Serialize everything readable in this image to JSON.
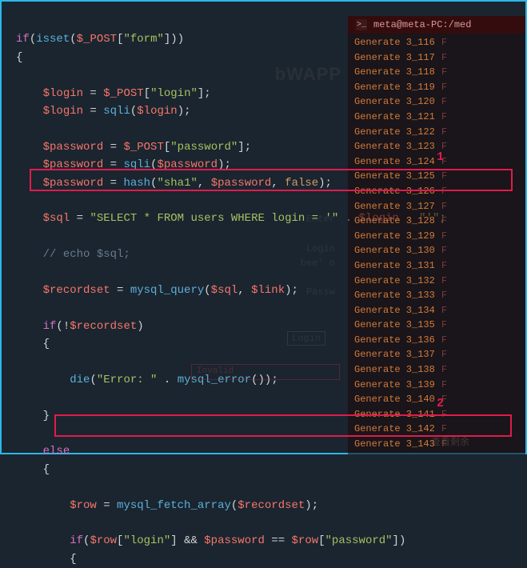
{
  "code": {
    "l1a": "if",
    "l1b": "(",
    "l1c": "isset",
    "l1d": "(",
    "l1e": "$_POST",
    "l1f": "[",
    "l1g": "\"form\"",
    "l1h": "]))",
    "l2": "{",
    "l3a": "$login",
    "l3b": " = ",
    "l3c": "$_POST",
    "l3d": "[",
    "l3e": "\"login\"",
    "l3f": "];",
    "l4a": "$login",
    "l4b": " = ",
    "l4c": "sqli",
    "l4d": "(",
    "l4e": "$login",
    "l4f": ");",
    "l5a": "$password",
    "l5b": " = ",
    "l5c": "$_POST",
    "l5d": "[",
    "l5e": "\"password\"",
    "l5f": "];",
    "l6a": "$password",
    "l6b": " = ",
    "l6c": "sqli",
    "l6d": "(",
    "l6e": "$password",
    "l6f": ");",
    "l7a": "$password",
    "l7b": " = ",
    "l7c": "hash",
    "l7d": "(",
    "l7e": "\"sha1\"",
    "l7f": ", ",
    "l7g": "$password",
    "l7h": ", ",
    "l7i": "false",
    "l7j": ");",
    "l8a": "$sql",
    "l8b": " = ",
    "l8c": "\"SELECT * FROM users WHERE login = '\"",
    "l8d": " . ",
    "l8e": "$login",
    "l8f": " . ",
    "l8g": "\"'\"",
    "l8h": ";",
    "l9": "// echo $sql;",
    "l10a": "$recordset",
    "l10b": " = ",
    "l10c": "mysql_query",
    "l10d": "(",
    "l10e": "$sql",
    "l10f": ", ",
    "l10g": "$link",
    "l10h": ");",
    "l11a": "if",
    "l11b": "(!",
    "l11c": "$recordset",
    "l11d": ")",
    "l12": "{",
    "l13a": "die",
    "l13b": "(",
    "l13c": "\"Error: \"",
    "l13d": " . ",
    "l13e": "mysql_error",
    "l13f": "());",
    "l14": "}",
    "l15": "else",
    "l16": "{",
    "l17a": "$row",
    "l17b": " = ",
    "l17c": "mysql_fetch_array",
    "l17d": "(",
    "l17e": "$recordset",
    "l17f": ");",
    "l18a": "if",
    "l18b": "(",
    "l18c": "$row",
    "l18d": "[",
    "l18e": "\"login\"",
    "l18f": "] && ",
    "l18g": "$password",
    "l18h": " == ",
    "l18i": "$row",
    "l18j": "[",
    "l18k": "\"password\"",
    "l18l": "])",
    "l19": "{"
  },
  "annotations": {
    "num1": "1",
    "num2": "2"
  },
  "terminal": {
    "title": "meta@meta-PC:/med",
    "items": [
      "Generate 3_116",
      "Generate 3_117",
      "Generate 3_118",
      "Generate 3_119",
      "Generate 3_120",
      "Generate 3_121",
      "Generate 3_122",
      "Generate 3_123",
      "Generate 3_124",
      "Generate 3_125",
      "Generate 3_126",
      "Generate 3_127",
      "Generate 3_128",
      "Generate 3_129",
      "Generate 3_130",
      "Generate 3_131",
      "Generate 3_132",
      "Generate 3_133",
      "Generate 3_134",
      "Generate 3_135",
      "Generate 3_136",
      "Generate 3_137",
      "Generate 3_138",
      "Generate 3_139",
      "Generate 3_140",
      "Generate 3_141",
      "Generate 3_142",
      "Generate 3_143"
    ],
    "after": "F"
  },
  "background": {
    "app_title": "bWAPP",
    "enter_label": "Enter",
    "login_label": "Login",
    "login_value": "bee' o",
    "passw_label": "Passw",
    "login_btn": "Login",
    "invalid": "Invalid",
    "bottom_text": "查看剩余"
  }
}
